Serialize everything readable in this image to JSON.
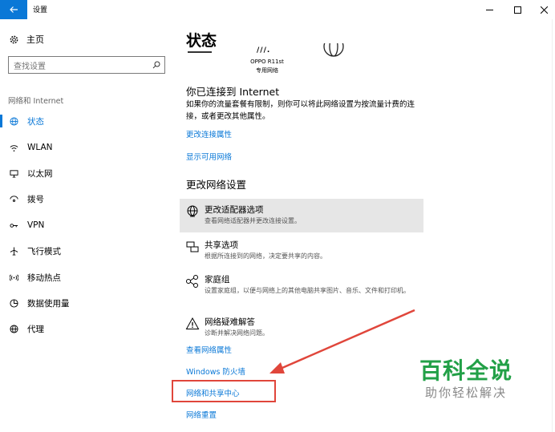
{
  "window": {
    "title": "设置",
    "accent": "#0a78d7"
  },
  "sidebar": {
    "home_label": "主页",
    "search_placeholder": "查找设置",
    "section_label": "网络和 Internet",
    "items": [
      {
        "label": "状态",
        "icon": "globe-icon",
        "active": true
      },
      {
        "label": "WLAN",
        "icon": "wifi-icon"
      },
      {
        "label": "以太网",
        "icon": "ethernet-icon"
      },
      {
        "label": "拨号",
        "icon": "dialup-icon"
      },
      {
        "label": "VPN",
        "icon": "vpn-icon"
      },
      {
        "label": "飞行模式",
        "icon": "airplane-icon"
      },
      {
        "label": "移动热点",
        "icon": "hotspot-icon"
      },
      {
        "label": "数据使用量",
        "icon": "data-usage-icon"
      },
      {
        "label": "代理",
        "icon": "proxy-globe-icon"
      }
    ]
  },
  "main": {
    "title": "状态",
    "network_fragment": "///.",
    "device_name": "OPPO R11st",
    "device_status": "专用网络",
    "connected_title": "你已连接到 Internet",
    "connected_desc": "如果你的流量套餐有限制，则你可以将此网络设置为按流量计费的连接，或者更改其他属性。",
    "links": {
      "change_props": "更改连接属性",
      "show_networks": "显示可用网络"
    },
    "change_section_title": "更改网络设置",
    "options": [
      {
        "title": "更改适配器选项",
        "desc": "查看网络适配器并更改连接设置。",
        "icon": "adapter-globe-icon"
      },
      {
        "title": "共享选项",
        "desc": "根据所连接到的网络，决定要共享的内容。",
        "icon": "sharing-icon"
      },
      {
        "title": "家庭组",
        "desc": "设置家庭组，以便与网络上的其他电脑共享图片、音乐、文件和打印机。",
        "icon": "homegroup-icon"
      },
      {
        "title": "网络疑难解答",
        "desc": "诊断并解决网络问题。",
        "icon": "warning-icon"
      }
    ],
    "bottom_links": {
      "view_props": "查看网络属性",
      "firewall": "Windows 防火墙",
      "sharing_center": "网络和共享中心",
      "reset": "网络重置"
    }
  },
  "annotation": {
    "color": "#e0463b"
  },
  "watermark": {
    "main": "百科全说",
    "sub": "助你轻松解决",
    "color": "#22a047"
  }
}
